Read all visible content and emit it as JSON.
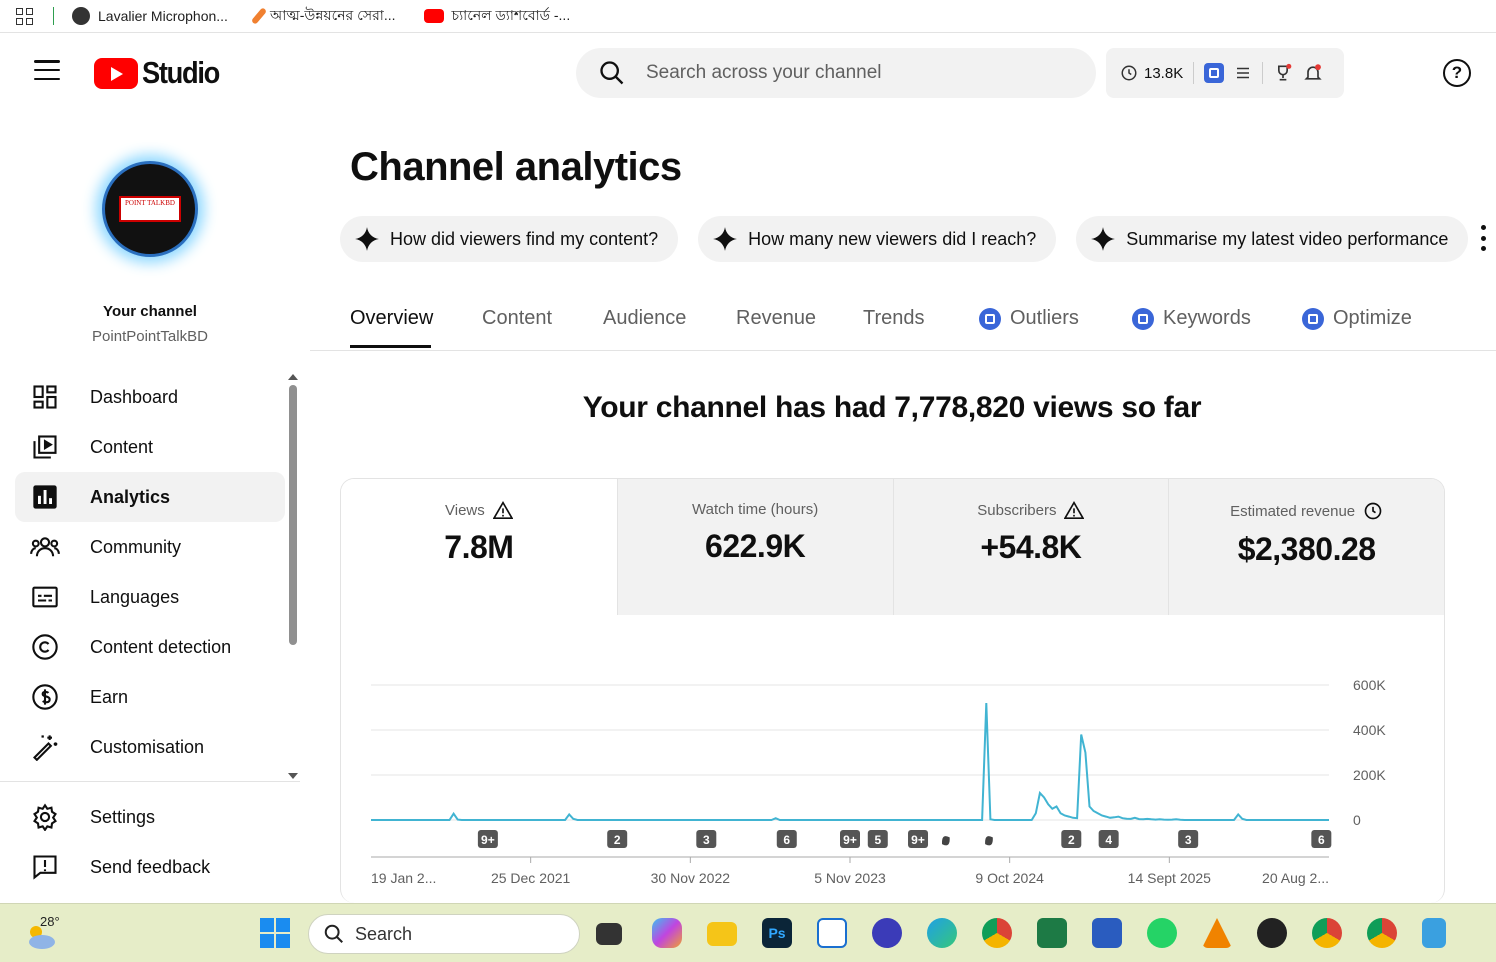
{
  "bookmarks": [
    {
      "label": "Lavalier Microphon...",
      "color": "#333333"
    },
    {
      "label": "আত্ম-উন্নয়নের সেরা...",
      "color": "#f08030"
    },
    {
      "label": "চ্যানেল ড্যাশবোর্ড -...",
      "color": "#ff0000"
    }
  ],
  "header": {
    "logo_text": "Studio",
    "search_placeholder": "Search across your channel",
    "views_count": "13.8K",
    "help_label": "?"
  },
  "sidebar": {
    "avatar_text": "POINT TALKBD",
    "your_channel": "Your channel",
    "channel_name": "PointPointTalkBD",
    "items": [
      {
        "label": "Dashboard",
        "icon": "dashboard-icon"
      },
      {
        "label": "Content",
        "icon": "content-icon"
      },
      {
        "label": "Analytics",
        "icon": "analytics-icon",
        "active": true
      },
      {
        "label": "Community",
        "icon": "community-icon"
      },
      {
        "label": "Languages",
        "icon": "subtitles-icon"
      },
      {
        "label": "Content detection",
        "icon": "copyright-icon"
      },
      {
        "label": "Earn",
        "icon": "dollar-icon"
      },
      {
        "label": "Customisation",
        "icon": "magic-wand-icon"
      }
    ],
    "bottom_items": [
      {
        "label": "Settings",
        "icon": "gear-icon"
      },
      {
        "label": "Send feedback",
        "icon": "feedback-icon"
      }
    ]
  },
  "main": {
    "title": "Channel analytics",
    "chips": [
      "How did viewers find my content?",
      "How many new viewers did I reach?",
      "Summarise my latest video performance"
    ],
    "tabs": [
      "Overview",
      "Content",
      "Audience",
      "Revenue",
      "Trends",
      "Outliers",
      "Keywords",
      "Optimize"
    ],
    "headline": "Your channel has had 7,778,820 views so far",
    "metrics": [
      {
        "label": "Views",
        "value": "7.8M",
        "icon": "warning-icon"
      },
      {
        "label": "Watch time (hours)",
        "value": "622.9K",
        "icon": ""
      },
      {
        "label": "Subscribers",
        "value": "+54.8K",
        "icon": "warning-icon"
      },
      {
        "label": "Estimated revenue",
        "value": "$2,380.28",
        "icon": "clock-icon"
      }
    ]
  },
  "chart_data": {
    "type": "line",
    "x_tick_labels": [
      "19 Jan 2...",
      "25 Dec 2021",
      "30 Nov 2022",
      "5 Nov 2023",
      "9 Oct 2024",
      "14 Sept 2025",
      "20 Aug 2..."
    ],
    "y_tick_labels": [
      "600K",
      "400K",
      "200K",
      "0"
    ],
    "ylim": [
      0,
      600000
    ],
    "grid": true,
    "y_axis_side": "right",
    "color": "#41b4d2",
    "series_values": [
      0,
      0,
      0,
      0,
      0,
      0,
      0,
      0,
      0,
      0,
      0,
      0,
      0,
      0,
      0,
      0,
      0,
      0,
      0,
      0,
      28000,
      2000,
      0,
      0,
      0,
      0,
      0,
      0,
      0,
      0,
      0,
      0,
      0,
      0,
      0,
      0,
      0,
      0,
      0,
      0,
      0,
      0,
      0,
      0,
      0,
      0,
      0,
      0,
      25000,
      5000,
      0,
      0,
      0,
      0,
      0,
      0,
      0,
      0,
      0,
      0,
      0,
      0,
      0,
      0,
      0,
      0,
      0,
      0,
      0,
      0,
      0,
      0,
      0,
      0,
      0,
      0,
      0,
      0,
      0,
      0,
      0,
      0,
      0,
      0,
      0,
      0,
      0,
      0,
      0,
      0,
      0,
      0,
      0,
      0,
      0,
      0,
      0,
      0,
      8000,
      0,
      0,
      0,
      0,
      0,
      0,
      0,
      0,
      0,
      0,
      0,
      0,
      0,
      0,
      0,
      0,
      0,
      0,
      0,
      0,
      0,
      0,
      0,
      0,
      0,
      0,
      0,
      0,
      0,
      0,
      0,
      0,
      0,
      0,
      0,
      0,
      0,
      0,
      0,
      0,
      0,
      0,
      0,
      0,
      0,
      0,
      0,
      0,
      0,
      0,
      520000,
      3000,
      0,
      0,
      0,
      0,
      0,
      0,
      0,
      0,
      0,
      0,
      30000,
      120000,
      100000,
      70000,
      50000,
      60000,
      30000,
      20000,
      15000,
      10000,
      8000,
      380000,
      300000,
      60000,
      40000,
      30000,
      20000,
      15000,
      10000,
      12000,
      15000,
      8000,
      6000,
      5000,
      10000,
      4000,
      3000,
      5000,
      3000,
      2000,
      3000,
      2000,
      1000,
      2000,
      3000,
      1000,
      0,
      0,
      0,
      0,
      0,
      0,
      0,
      0,
      0,
      0,
      0,
      0,
      0,
      25000,
      5000,
      0,
      0,
      0,
      0,
      0,
      0,
      0,
      0,
      0,
      0,
      0,
      0,
      0,
      0,
      0,
      0,
      0,
      0,
      0,
      0,
      0
    ],
    "markers": [
      {
        "label": "9+",
        "pos": 0.122
      },
      {
        "label": "2",
        "pos": 0.257
      },
      {
        "label": "3",
        "pos": 0.35
      },
      {
        "label": "6",
        "pos": 0.434
      },
      {
        "label": "9+",
        "pos": 0.5
      },
      {
        "label": "5",
        "pos": 0.529
      },
      {
        "label": "9+",
        "pos": 0.571
      },
      {
        "label": "shorts",
        "pos": 0.599
      },
      {
        "label": "shorts",
        "pos": 0.644
      },
      {
        "label": "2",
        "pos": 0.731
      },
      {
        "label": "4",
        "pos": 0.77
      },
      {
        "label": "3",
        "pos": 0.853
      },
      {
        "label": "6",
        "pos": 0.992
      }
    ]
  },
  "taskbar": {
    "temperature": "28°",
    "search_label": "Search"
  }
}
